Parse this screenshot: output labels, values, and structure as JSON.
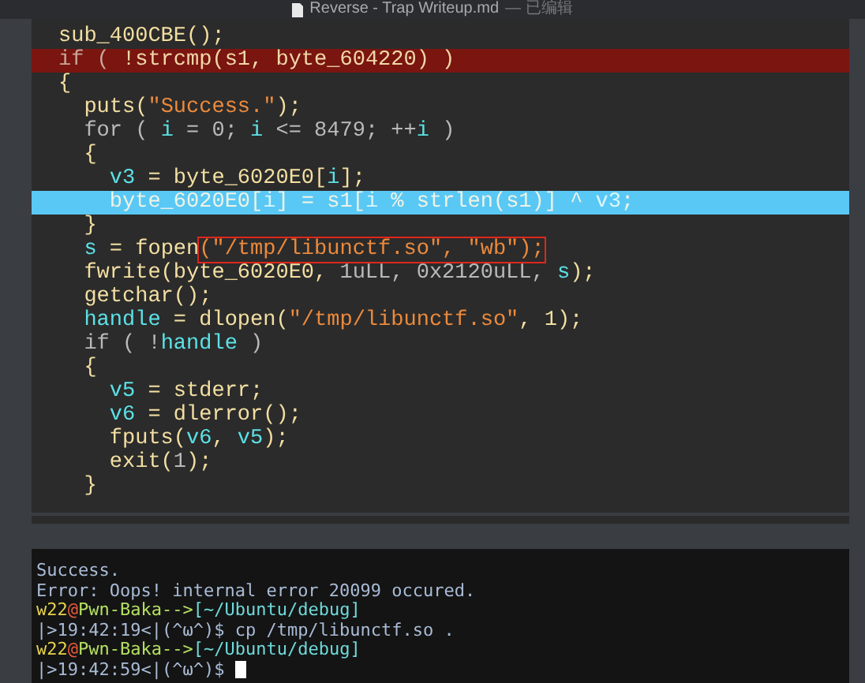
{
  "window": {
    "title": "Reverse - Trap  Writeup.md",
    "status": "— 已编辑"
  },
  "code_lines": [
    {
      "kind": "normal",
      "tokens": [
        {
          "kind": "plain",
          "text": "sub_400CBE();"
        }
      ]
    },
    {
      "kind": "error",
      "tokens": [
        {
          "kind": "keyword",
          "text": "if ( "
        },
        {
          "kind": "plain",
          "text": "!strcmp(s1, byte_604220) )"
        }
      ]
    },
    {
      "kind": "normal",
      "tokens": [
        {
          "kind": "plain",
          "text": "{"
        }
      ]
    },
    {
      "kind": "normal",
      "tokens": [
        {
          "kind": "plain",
          "text": "  puts("
        },
        {
          "kind": "string",
          "text": "\"Success.\""
        },
        {
          "kind": "plain",
          "text": ");"
        }
      ]
    },
    {
      "kind": "normal",
      "tokens": [
        {
          "kind": "keyword",
          "text": "  for ( "
        },
        {
          "kind": "var",
          "text": "i"
        },
        {
          "kind": "keyword",
          "text": " = 0; "
        },
        {
          "kind": "var",
          "text": "i"
        },
        {
          "kind": "keyword",
          "text": " <= 8479; ++"
        },
        {
          "kind": "var",
          "text": "i"
        },
        {
          "kind": "keyword",
          "text": " )"
        }
      ]
    },
    {
      "kind": "normal",
      "tokens": [
        {
          "kind": "plain",
          "text": "  {"
        }
      ]
    },
    {
      "kind": "normal",
      "tokens": [
        {
          "kind": "var",
          "text": "    v3"
        },
        {
          "kind": "plain",
          "text": " = byte_6020E0["
        },
        {
          "kind": "var",
          "text": "i"
        },
        {
          "kind": "plain",
          "text": "];"
        }
      ]
    },
    {
      "kind": "current",
      "tokens": [
        {
          "kind": "plain",
          "text": "    byte_6020E0["
        },
        {
          "kind": "var",
          "text": "i"
        },
        {
          "kind": "plain",
          "text": "] = s1["
        },
        {
          "kind": "var",
          "text": "i"
        },
        {
          "kind": "plain",
          "text": " % strlen(s1)] ^ "
        },
        {
          "kind": "var",
          "text": "v3"
        },
        {
          "kind": "plain",
          "text": ";"
        }
      ]
    },
    {
      "kind": "normal",
      "tokens": [
        {
          "kind": "plain",
          "text": "  }"
        }
      ]
    },
    {
      "kind": "normal",
      "tokens": [
        {
          "kind": "var",
          "text": "  s"
        },
        {
          "kind": "plain",
          "text": " = fopen"
        },
        {
          "kind": "string",
          "text": "(\"/tmp/libunctf.so\", \"wb\");",
          "boxed": true
        }
      ]
    },
    {
      "kind": "normal",
      "tokens": [
        {
          "kind": "plain",
          "text": "  fwrite(byte_6020E0, "
        },
        {
          "kind": "keyword",
          "text": "1uLL, 0x2120uLL, "
        },
        {
          "kind": "var",
          "text": "s"
        },
        {
          "kind": "plain",
          "text": ");"
        }
      ]
    },
    {
      "kind": "normal",
      "tokens": [
        {
          "kind": "plain",
          "text": "  getchar();"
        }
      ]
    },
    {
      "kind": "normal",
      "tokens": [
        {
          "kind": "var",
          "text": "  handle"
        },
        {
          "kind": "plain",
          "text": " = dlopen("
        },
        {
          "kind": "string",
          "text": "\"/tmp/libunctf.so\""
        },
        {
          "kind": "plain",
          "text": ", 1);"
        }
      ]
    },
    {
      "kind": "normal",
      "tokens": [
        {
          "kind": "keyword",
          "text": "  if ( !"
        },
        {
          "kind": "var",
          "text": "handle"
        },
        {
          "kind": "keyword",
          "text": " )"
        }
      ]
    },
    {
      "kind": "normal",
      "tokens": [
        {
          "kind": "plain",
          "text": "  {"
        }
      ]
    },
    {
      "kind": "normal",
      "tokens": [
        {
          "kind": "var",
          "text": "    v5"
        },
        {
          "kind": "plain",
          "text": " = stderr;"
        }
      ]
    },
    {
      "kind": "normal",
      "tokens": [
        {
          "kind": "var",
          "text": "    v6"
        },
        {
          "kind": "plain",
          "text": " = dlerror();"
        }
      ]
    },
    {
      "kind": "normal",
      "tokens": [
        {
          "kind": "plain",
          "text": "    fputs("
        },
        {
          "kind": "var",
          "text": "v6"
        },
        {
          "kind": "plain",
          "text": ", "
        },
        {
          "kind": "var",
          "text": "v5"
        },
        {
          "kind": "plain",
          "text": ");"
        }
      ]
    },
    {
      "kind": "normal",
      "tokens": [
        {
          "kind": "plain",
          "text": "    exit("
        },
        {
          "kind": "keyword",
          "text": "1"
        },
        {
          "kind": "plain",
          "text": ");"
        }
      ]
    },
    {
      "kind": "normal",
      "tokens": [
        {
          "kind": "plain",
          "text": "  }"
        }
      ]
    }
  ],
  "terminal_lines": [
    {
      "tokens": [
        {
          "kind": "output",
          "text": "Success."
        }
      ]
    },
    {
      "tokens": [
        {
          "kind": "output",
          "text": "Error: Oops! internal error 20099 occured."
        }
      ]
    },
    {
      "tokens": [
        {
          "kind": "user",
          "text": "w22"
        },
        {
          "kind": "at",
          "text": "@"
        },
        {
          "kind": "host",
          "text": "Pwn-Baka-->"
        },
        {
          "kind": "path",
          "text": "[~/Ubuntu/debug]"
        }
      ]
    },
    {
      "tokens": [
        {
          "kind": "output",
          "text": "|>19:42:19<|(^ω^)$ cp /tmp/libunctf.so ."
        }
      ]
    },
    {
      "tokens": [
        {
          "kind": "user",
          "text": "w22"
        },
        {
          "kind": "at",
          "text": "@"
        },
        {
          "kind": "host",
          "text": "Pwn-Baka-->"
        },
        {
          "kind": "path",
          "text": "[~/Ubuntu/debug]"
        }
      ]
    },
    {
      "cursor": true,
      "tokens": [
        {
          "kind": "output",
          "text": "|>19:42:59<|(^ω^)$ "
        }
      ]
    }
  ]
}
